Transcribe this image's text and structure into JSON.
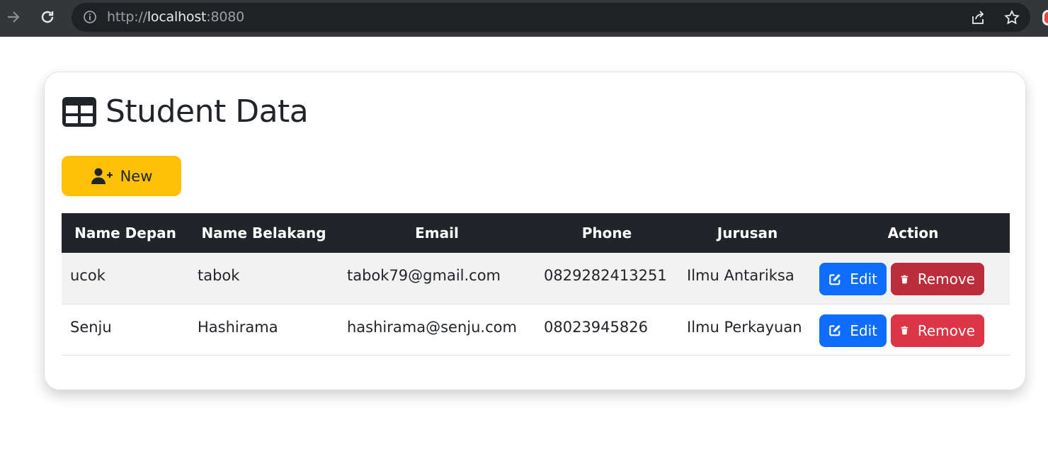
{
  "browser": {
    "url_scheme": "http://",
    "url_host": "localhost",
    "url_port": ":8080"
  },
  "page": {
    "title": "Student Data",
    "title_icon": "table-icon",
    "new_button_label": "New",
    "new_button_icon": "user-plus-icon"
  },
  "table": {
    "headers": [
      "Name Depan",
      "Name Belakang",
      "Email",
      "Phone",
      "Jurusan",
      "Action"
    ],
    "rows": [
      {
        "first": "ucok",
        "last": "tabok",
        "email": "tabok79@gmail.com",
        "phone": "0829282413251",
        "major": "Ilmu Antariksa",
        "edit": "Edit",
        "remove": "Remove"
      },
      {
        "first": "Senju",
        "last": "Hashirama",
        "email": "hashirama@senju.com",
        "phone": "08023945826",
        "major": "Ilmu Perkayuan",
        "edit": "Edit",
        "remove": "Remove"
      }
    ]
  },
  "colors": {
    "new_button": "#ffc107",
    "edit_button": "#0d6efd",
    "remove_button": "#dc3545",
    "table_header": "#212529"
  }
}
